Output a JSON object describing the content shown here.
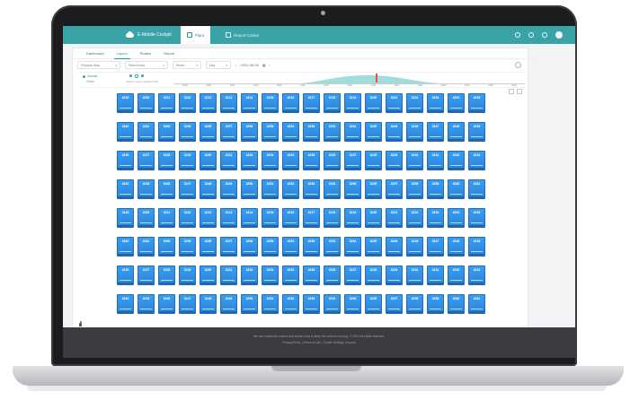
{
  "app": {
    "brand": "E-Mobile Cockpit",
    "tabs": [
      {
        "label": "Plant",
        "active": true
      },
      {
        "label": "Report Center",
        "active": false
      }
    ]
  },
  "subtabs": [
    {
      "label": "Dashboard",
      "active": false
    },
    {
      "label": "Layout",
      "active": true
    },
    {
      "label": "Routes",
      "active": false
    },
    {
      "label": "Report",
      "active": false
    }
  ],
  "filters": {
    "map": "Physical Map",
    "hall": "Select Area",
    "mode": "Reset",
    "period": "Day",
    "date": "2022-06-09"
  },
  "status": {
    "normal_label": "Normal",
    "other_label": "Other",
    "note": "SELECT EACH SELECTION"
  },
  "timeline_labels": [
    "0900",
    "1000",
    "1100",
    "1200",
    "1300",
    "1400",
    "1500",
    "1600",
    "1700",
    "1800",
    "1900",
    "2000",
    "2100",
    "2200",
    "2300"
  ],
  "timeline_marker": 0.58,
  "slot_rows": [
    [
      "3218",
      "3263",
      "3211",
      "3232",
      "3212",
      "3213",
      "3214",
      "3215",
      "3216",
      "3217",
      "3218",
      "3219",
      "3220",
      "3221",
      "3222",
      "3223",
      "3224",
      "3225"
    ],
    [
      "3262",
      "3261",
      "3260",
      "3259",
      "3258",
      "3257",
      "3256",
      "3255",
      "3254",
      "3253",
      "3252",
      "3251",
      "3250",
      "3249",
      "3248",
      "3247",
      "3246",
      "3245"
    ],
    [
      "3226",
      "3227",
      "3228",
      "3229",
      "3230",
      "3231",
      "3232",
      "3233",
      "3234",
      "3235",
      "3236",
      "3237",
      "3238",
      "3239",
      "3240",
      "3241",
      "3242",
      "3243"
    ],
    [
      "3244",
      "3245",
      "3246",
      "3247",
      "3248",
      "3249",
      "3250",
      "3251",
      "3252",
      "3253",
      "3254",
      "3255",
      "3256",
      "3257",
      "3258",
      "3259",
      "3260",
      "3261"
    ],
    [
      "3118",
      "3263",
      "3211",
      "3232",
      "3212",
      "3213",
      "3214",
      "3215",
      "3216",
      "3217",
      "3218",
      "3219",
      "3220",
      "3221",
      "3222",
      "3223",
      "3224",
      "3225"
    ],
    [
      "3262",
      "3261",
      "3260",
      "3259",
      "3258",
      "3257",
      "3256",
      "3255",
      "3254",
      "3253",
      "3252",
      "3251",
      "3250",
      "3249",
      "3248",
      "3247",
      "3246",
      "3245"
    ],
    [
      "3226",
      "3227",
      "3228",
      "3229",
      "3230",
      "3231",
      "3232",
      "3233",
      "3234",
      "3235",
      "3236",
      "3237",
      "3238",
      "3239",
      "3240",
      "3241",
      "3242",
      "3243"
    ],
    [
      "3244",
      "3245",
      "3246",
      "3247",
      "3248",
      "3249",
      "3250",
      "3251",
      "3252",
      "3253",
      "3254",
      "3255",
      "3256",
      "3257",
      "3258",
      "3259",
      "3260",
      "3261"
    ]
  ],
  "footer": {
    "line1": "We use functional cookies and similar tools to keep the services running. © 2022 All rights reserved.",
    "line2": "Privacy Policy | Terms of Use | Cookie Settings | Imprint"
  },
  "colors": {
    "accent": "#3aa3a7",
    "slot": "#2f8ee0",
    "footer": "#3b3c3f"
  }
}
